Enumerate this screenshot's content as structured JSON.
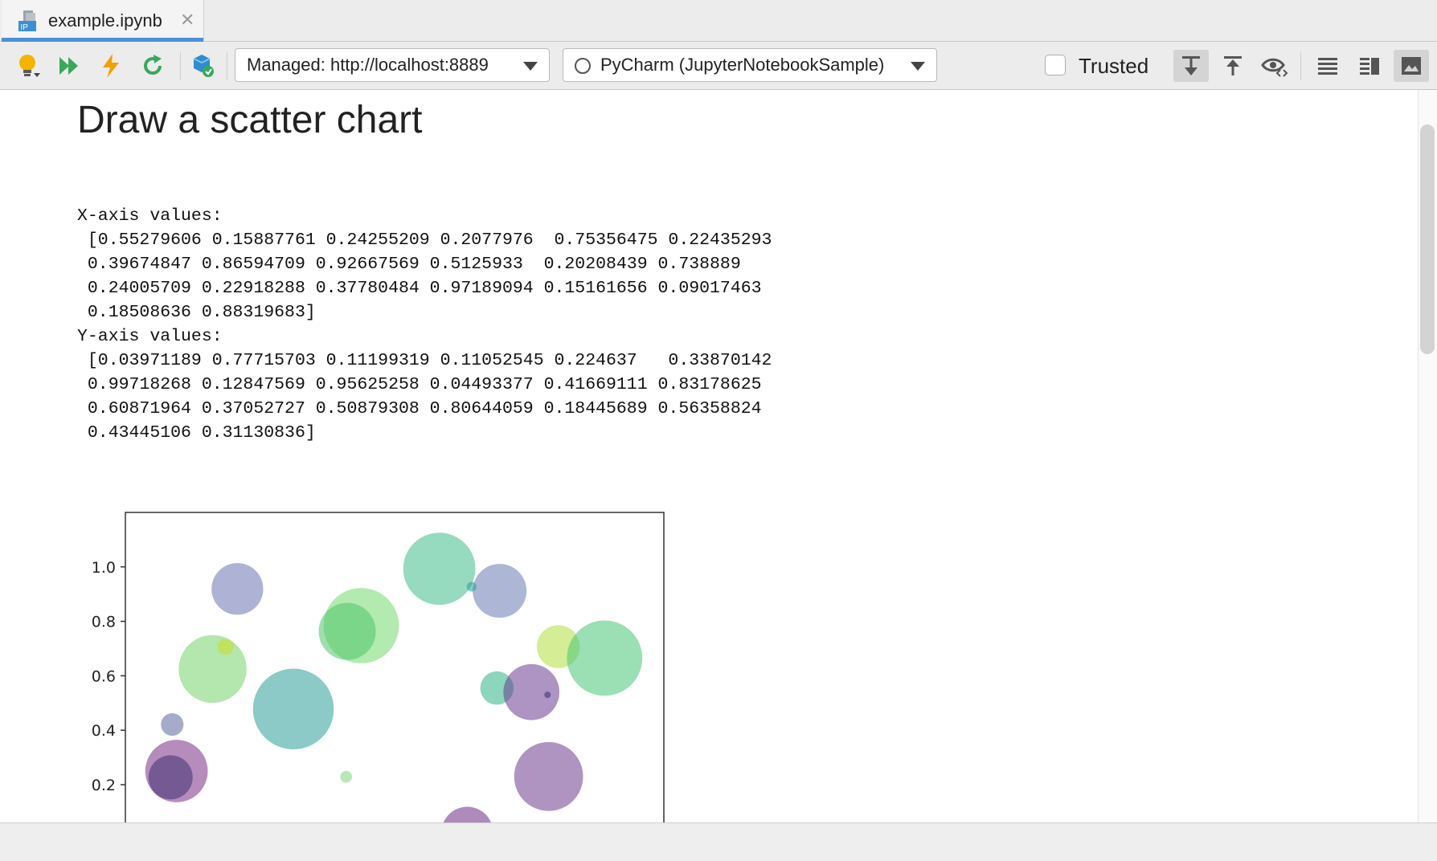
{
  "tab": {
    "title": "example.ipynb",
    "icon": "jupyter-notebook-file-icon",
    "icon_text": "IP"
  },
  "toolbar": {
    "server": "Managed: http://localhost:8889",
    "kernel": "PyCharm (JupyterNotebookSample)",
    "trusted_label": "Trusted"
  },
  "cell": {
    "heading": "Draw a scatter chart",
    "output_lines": [
      "X-axis values:",
      " [0.55279606 0.15887761 0.24255209 0.2077976  0.75356475 0.22435293",
      " 0.39674847 0.86594709 0.92667569 0.5125933  0.20208439 0.738889",
      " 0.24005709 0.22918288 0.37780484 0.97189094 0.15161656 0.09017463",
      " 0.18508636 0.88319683]",
      "Y-axis values:",
      " [0.03971189 0.77715703 0.11199319 0.11052545 0.224637   0.33870142",
      " 0.99718268 0.12847569 0.95625258 0.04493377 0.41669111 0.83178625",
      " 0.60871964 0.37052727 0.50879308 0.80644059 0.18445689 0.56358824",
      " 0.43445106 0.31130836]"
    ]
  },
  "chart_data": {
    "type": "scatter",
    "ylim": [
      0.02,
      1.2
    ],
    "xlim": [
      0.0,
      1.0
    ],
    "y_ticks": [
      "0.2",
      "0.4",
      "0.6",
      "0.8",
      "1.0"
    ],
    "points": [
      {
        "x": 0.208,
        "y": 0.919,
        "r": 0.048,
        "color": "#6b72b0"
      },
      {
        "x": 0.583,
        "y": 0.993,
        "r": 0.067,
        "color": "#3fbb8c"
      },
      {
        "x": 0.695,
        "y": 0.912,
        "r": 0.05,
        "color": "#6a7ab0"
      },
      {
        "x": 0.643,
        "y": 0.927,
        "r": 0.009,
        "color": "#1f9f92"
      },
      {
        "x": 0.438,
        "y": 0.784,
        "r": 0.07,
        "color": "#73d86d"
      },
      {
        "x": 0.412,
        "y": 0.763,
        "r": 0.053,
        "color": "#4fc46a"
      },
      {
        "x": 0.162,
        "y": 0.625,
        "r": 0.063,
        "color": "#74d46a"
      },
      {
        "x": 0.186,
        "y": 0.707,
        "r": 0.015,
        "color": "#c8e020"
      },
      {
        "x": 0.804,
        "y": 0.707,
        "r": 0.04,
        "color": "#b2df3c"
      },
      {
        "x": 0.89,
        "y": 0.665,
        "r": 0.07,
        "color": "#49c479"
      },
      {
        "x": 0.312,
        "y": 0.478,
        "r": 0.075,
        "color": "#2c9f97"
      },
      {
        "x": 0.69,
        "y": 0.555,
        "r": 0.031,
        "color": "#2bb487"
      },
      {
        "x": 0.754,
        "y": 0.54,
        "r": 0.052,
        "color": "#6a3d8f"
      },
      {
        "x": 0.784,
        "y": 0.53,
        "r": 0.006,
        "color": "#3d2c6f"
      },
      {
        "x": 0.087,
        "y": 0.421,
        "r": 0.021,
        "color": "#5c669f"
      },
      {
        "x": 0.095,
        "y": 0.25,
        "r": 0.058,
        "color": "#7a2d85"
      },
      {
        "x": 0.084,
        "y": 0.227,
        "r": 0.041,
        "color": "#3f2f6f"
      },
      {
        "x": 0.41,
        "y": 0.229,
        "r": 0.011,
        "color": "#7bd77a"
      },
      {
        "x": 0.786,
        "y": 0.23,
        "r": 0.064,
        "color": "#6d3d8f"
      },
      {
        "x": 0.635,
        "y": 0.024,
        "r": 0.048,
        "color": "#6c2c85"
      }
    ]
  },
  "colors": {
    "accent": "#4a90d9",
    "run_green": "#3aa85a",
    "bulb": "#f4b400",
    "lightning": "#f0a000"
  }
}
